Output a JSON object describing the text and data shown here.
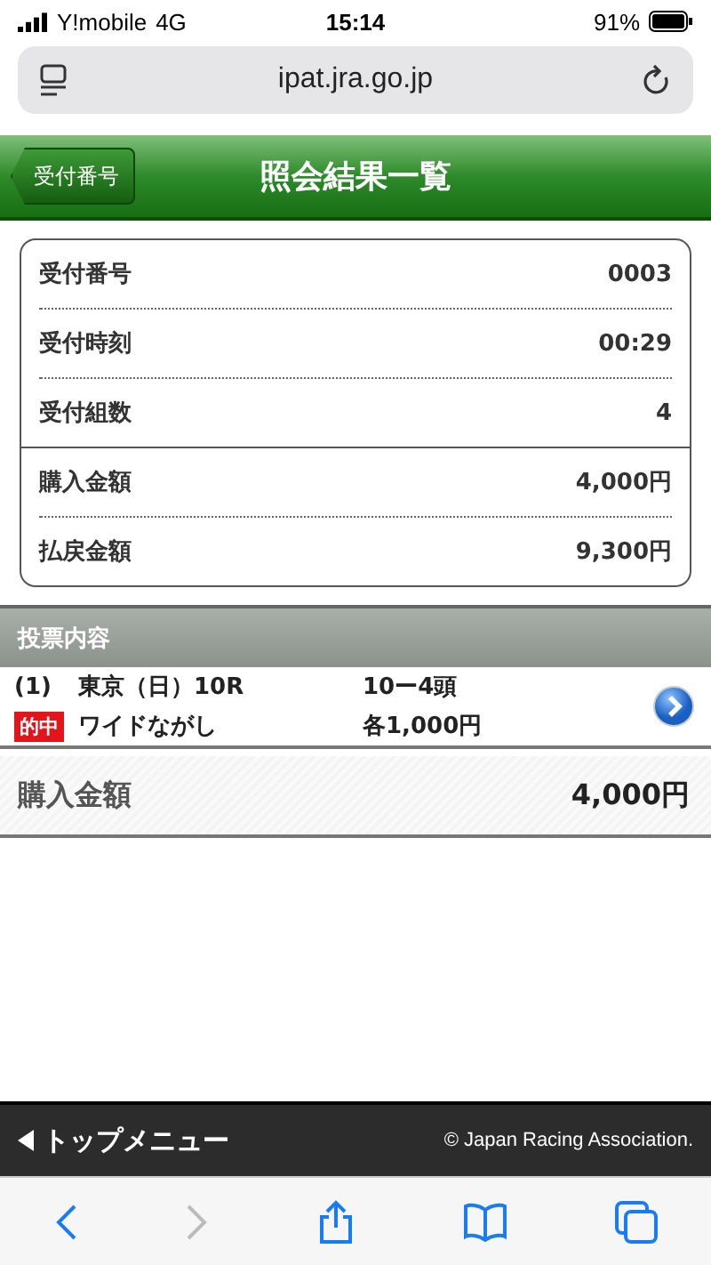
{
  "status_bar": {
    "carrier": "Y!mobile",
    "network": "4G",
    "time": "15:14",
    "battery": "91%"
  },
  "browser": {
    "url": "ipat.jra.go.jp"
  },
  "header": {
    "back_button": "受付番号",
    "title": "照会結果一覧"
  },
  "summary": [
    {
      "rows": [
        {
          "label": "受付番号",
          "value": "0003"
        },
        {
          "label": "受付時刻",
          "value": "00:29"
        },
        {
          "label": "受付組数",
          "value": "4"
        }
      ]
    },
    {
      "rows": [
        {
          "label": "購入金額",
          "value": "4,000円"
        },
        {
          "label": "払戻金額",
          "value": "9,300円"
        }
      ]
    }
  ],
  "section": {
    "title": "投票内容"
  },
  "bets": [
    {
      "number": "(1)",
      "race": "東京（日）10R",
      "combination": "10ー4頭",
      "badge": "的中",
      "bet_type": "ワイドながし",
      "amount": "各1,000円"
    }
  ],
  "total": {
    "label": "購入金額",
    "value": "4,000円"
  },
  "footer": {
    "menu_link": "トップメニュー",
    "copyright": "© Japan Racing Association."
  },
  "toolbar": {
    "back_disabled": false,
    "forward_disabled": true
  }
}
